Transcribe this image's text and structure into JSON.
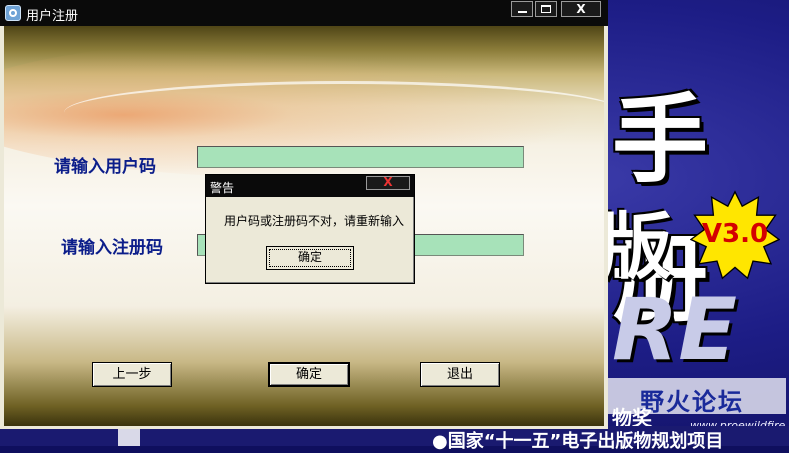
{
  "background": {
    "headline_char": "手册",
    "edition_char": "版",
    "wordmark_fragment": "RE",
    "version_badge": "V3.0",
    "forum_watermark": "野火论坛",
    "forum_url": "www.proewildfire.cn",
    "award_text": "物奖",
    "bottom_caption": "●国家“十一五”电子出版物规划项目"
  },
  "window": {
    "title": "用户注册",
    "controls": {
      "minimize": "",
      "maximize": "",
      "close": "X"
    }
  },
  "form": {
    "user_code_label": "请输入用户码",
    "user_code_value": "",
    "reg_code_label": "请输入注册码",
    "reg_code_value": ""
  },
  "buttons": {
    "prev": "上一步",
    "ok": "确定",
    "exit": "退出"
  },
  "alert": {
    "title": "警告",
    "close": "X",
    "message": "用户码或注册码不对，请重新输入",
    "ok": "确定"
  },
  "colors": {
    "label_blue": "#0b1d8a",
    "field_green": "#a7e2b9",
    "badge_red": "#d40000",
    "badge_yellow": "#ffe600"
  }
}
